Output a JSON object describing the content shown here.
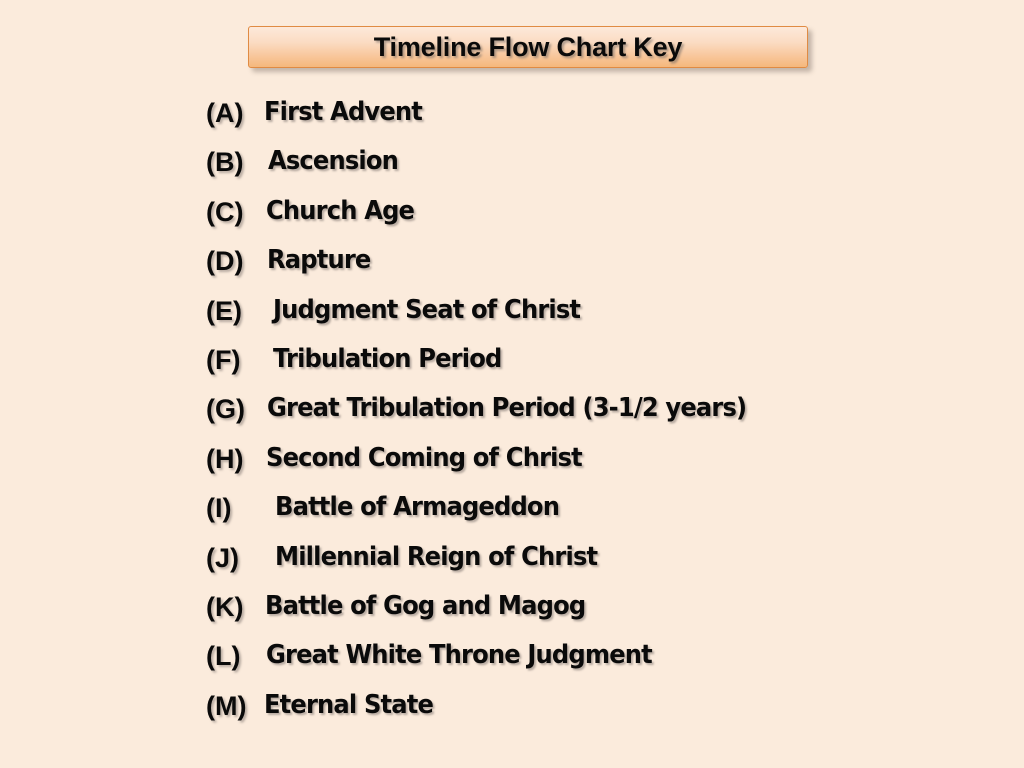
{
  "slide": {
    "background_color": "#FBEBDC",
    "title": {
      "text": "Timeline Flow Chart Key",
      "fill_top_color": "#FDE9DA",
      "fill_bottom_color": "#F5B87C",
      "border_color": "#E08B43",
      "text_color": "#0A0A0A"
    },
    "key_items": [
      {
        "label": "(A)",
        "text": "First Advent",
        "indent": 264
      },
      {
        "label": "(B)",
        "text": "Ascension",
        "indent": 268
      },
      {
        "label": "(C)",
        "text": "Church Age",
        "indent": 266
      },
      {
        "label": "(D)",
        "text": "Rapture",
        "indent": 267
      },
      {
        "label": "(E)",
        "text": "Judgment Seat of Christ",
        "indent": 273
      },
      {
        "label": "(F)",
        "text": "Tribulation Period",
        "indent": 273
      },
      {
        "label": "(G)",
        "text": "Great Tribulation Period (3-1/2 years)",
        "indent": 267
      },
      {
        "label": "(H)",
        "text": "Second Coming of Christ",
        "indent": 266
      },
      {
        "label": "(I)",
        "text": "Battle of Armageddon",
        "indent": 275
      },
      {
        "label": "(J)",
        "text": "Millennial Reign of Christ",
        "indent": 275
      },
      {
        "label": "(K)",
        "text": "Battle of Gog and Magog",
        "indent": 265
      },
      {
        "label": "(L)",
        "text": "Great White Throne Judgment",
        "indent": 266
      },
      {
        "label": "(M)",
        "text": "Eternal State",
        "indent": 264
      }
    ]
  }
}
